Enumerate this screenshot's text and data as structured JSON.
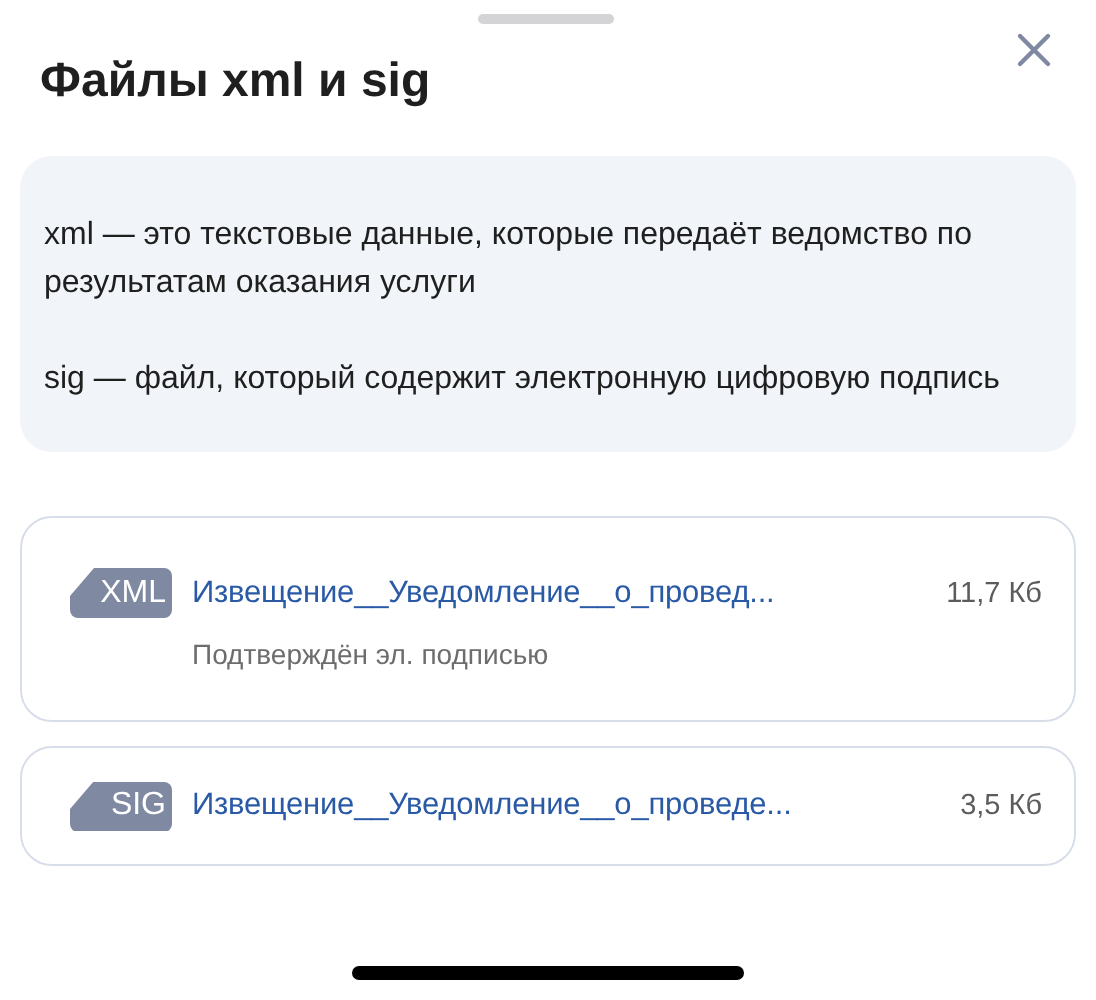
{
  "title": "Файлы xml и sig",
  "info": [
    "xml — это текстовые данные, которые передаёт ведомство по результатам оказания услуги",
    "sig — файл, который содержит электронную цифровую подпись"
  ],
  "files": [
    {
      "type": "XML",
      "name": "Извещение__Уведомление__о_провед...",
      "size": "11,7 Кб",
      "status": "Подтверждён эл. подписью"
    },
    {
      "type": "SIG",
      "name": "Извещение__Уведомление__о_проведе...",
      "size": "3,5 Кб"
    }
  ]
}
